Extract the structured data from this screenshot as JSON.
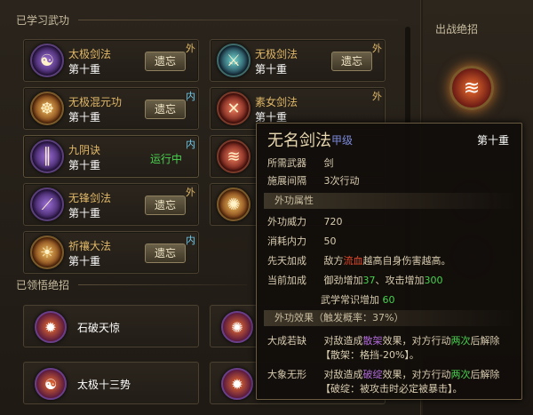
{
  "learned_section": {
    "title": "已学习武功",
    "skills": [
      {
        "name": "太极剑法",
        "level": "第十重",
        "tag": "外",
        "action": "遗忘",
        "icon": "sword-swirl-icon"
      },
      {
        "name": "无极剑法",
        "level": "第十重",
        "tag": "外",
        "action": "遗忘",
        "icon": "triple-sword-icon"
      },
      {
        "name": "无极混元功",
        "level": "第十重",
        "tag": "内",
        "action": "遗忘",
        "icon": "meditation-icon"
      },
      {
        "name": "素女剑法",
        "level": "第十重",
        "tag": "外",
        "action": "遗忘",
        "icon": "cross-swords-icon"
      },
      {
        "name": "九阴诀",
        "level": "第十重",
        "tag": "内",
        "status": "运行中",
        "icon": "pillar-icon"
      },
      {
        "name": "无锋剑法",
        "level": "第十重",
        "tag": "外",
        "action": "遗忘",
        "icon": "blade-icon"
      },
      {
        "name": "祈禳大法",
        "level": "第十重",
        "tag": "内",
        "action": "遗忘",
        "icon": "buddha-icon"
      }
    ]
  },
  "moves_section": {
    "title": "已领悟绝招",
    "moves": [
      {
        "name": "石破天惊",
        "icon": "burst-icon"
      },
      {
        "name": "太极十三势",
        "icon": "yin-yang-icon"
      }
    ]
  },
  "right_panel": {
    "title": "出战绝招",
    "icon": "claw-slash-icon"
  },
  "tooltip": {
    "title": "无名剑法",
    "grade": "甲级",
    "level": "第十重",
    "rows": [
      {
        "key": "所需武器",
        "value": "剑"
      },
      {
        "key": "施展间隔",
        "value": "3次行动"
      }
    ],
    "attr_band": "外功属性",
    "stats": [
      {
        "key": "外功威力",
        "value": "720"
      },
      {
        "key": "消耗内力",
        "value": "50"
      }
    ],
    "innate": {
      "key": "先天加成",
      "pre": "敌方",
      "highlight": "流血",
      "post": "越高自身伤害越高。"
    },
    "current": {
      "key": "当前加成",
      "line1_pre": "御劲增加",
      "line1_val1": "37",
      "line1_mid": "、攻击增加",
      "line1_val2": "300",
      "line2_pre": "武学常识增加",
      "line2_val": "60"
    },
    "effect_band": "外功效果（触发概率：37%）",
    "effects": [
      {
        "key": "大成若缺",
        "pre": "对敌造成",
        "status": "散架",
        "mid": "效果，对方行动",
        "count": "两次",
        "post": "后解除",
        "detail": "【散架：格挡-20%】。"
      },
      {
        "key": "大象无形",
        "pre": "对敌造成",
        "status": "破绽",
        "mid": "效果，对方行动",
        "count": "两次",
        "post": "后解除",
        "detail": "【破绽：被攻击时必定被暴击】。"
      }
    ]
  },
  "colors": {
    "accent_gold": "#e0b868",
    "running_green": "#49d24f",
    "inner_blue": "#6fc8e8",
    "status_red": "#e84a2a"
  }
}
